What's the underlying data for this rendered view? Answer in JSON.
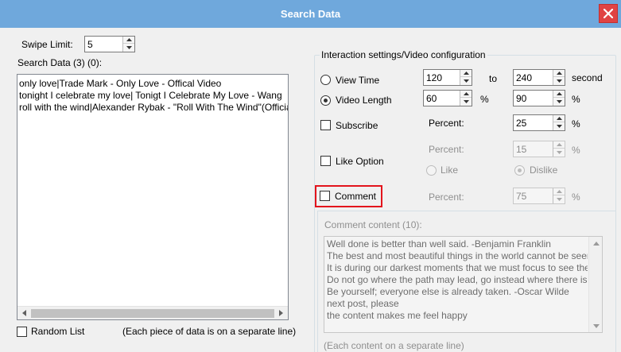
{
  "window": {
    "title": "Search Data",
    "close_icon": "close-icon"
  },
  "swipe_limit": {
    "label": "Swipe Limit:",
    "value": "5"
  },
  "search_data": {
    "label": "Search Data (3) (0):",
    "lines": [
      "only love|Trade Mark - Only Love - Offical Video",
      "tonight I celebrate my love| Tonigt I Celebrate My Love - Wang",
      "roll with the wind|Alexander Rybak - \"Roll With The Wind\"(Official"
    ]
  },
  "random_list": {
    "label": "Random List",
    "checked": false
  },
  "separate_note": "(Each piece of data is on a separate line)",
  "interaction": {
    "legend": "Interaction settings/Video configuration",
    "view_time": {
      "label": "View Time",
      "from": "120",
      "to_label": "to",
      "to": "240",
      "unit": "second",
      "selected": false
    },
    "video_length": {
      "label": "Video Length",
      "from": "60",
      "unit_from": "%",
      "to": "90",
      "unit_to": "%",
      "selected": true
    },
    "subscribe": {
      "label": "Subscribe",
      "checked": false,
      "percent_label": "Percent:",
      "percent": "25",
      "unit": "%"
    },
    "like": {
      "label": "Like Option",
      "checked": false,
      "percent_label": "Percent:",
      "percent": "15",
      "unit": "%",
      "like_label": "Like",
      "dislike_label": "Dislike",
      "dislike_selected": true
    },
    "comment": {
      "label": "Comment",
      "checked": false,
      "percent_label": "Percent:",
      "percent": "75",
      "unit": "%"
    }
  },
  "comment_content": {
    "legend": "Comment content (10):",
    "lines": [
      "Well done is better than well said. -Benjamin Franklin",
      "The best and most beautiful things in the world cannot be seen",
      "It is during our darkest moments that we must focus to see the",
      "Do not go where the path may lead, go instead where there is n",
      "Be yourself; everyone else is already taken. -Oscar Wilde",
      "next post, please",
      "the content makes me feel happy"
    ],
    "note": "(Each content on a separate line)"
  },
  "colors": {
    "titlebar": "#6fa8dc",
    "close": "#e04343",
    "highlight": "#e3141c"
  }
}
